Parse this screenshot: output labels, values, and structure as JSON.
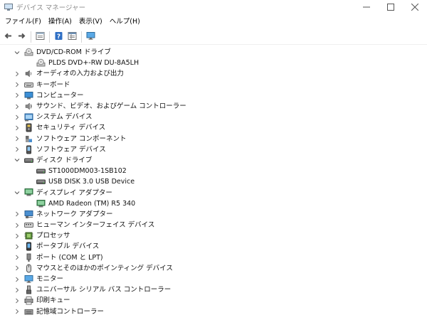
{
  "window": {
    "title": "デバイス マネージャー"
  },
  "menubar": [
    "ファイル(F)",
    "操作(A)",
    "表示(V)",
    "ヘルプ(H)"
  ],
  "toolbar": [
    {
      "name": "back-button",
      "icon": "arrow-left-icon"
    },
    {
      "name": "forward-button",
      "icon": "arrow-right-icon"
    },
    {
      "sep": true
    },
    {
      "name": "properties-button",
      "icon": "properties-icon"
    },
    {
      "sep": true
    },
    {
      "name": "help-button",
      "icon": "help-icon"
    },
    {
      "name": "view-button",
      "icon": "view-details-icon"
    },
    {
      "sep": true
    },
    {
      "name": "scan-hardware-button",
      "icon": "monitor-icon"
    }
  ],
  "tree": [
    {
      "level": 0,
      "label": "DVD/CD-ROM ドライブ",
      "expanded": true,
      "icon": "dvd-drive-icon"
    },
    {
      "level": 1,
      "label": "PLDS DVD+-RW DU-8A5LH",
      "icon": "dvd-drive-icon"
    },
    {
      "level": 0,
      "label": "オーディオの入力および出力",
      "expanded": false,
      "icon": "speaker-icon"
    },
    {
      "level": 0,
      "label": "キーボード",
      "expanded": false,
      "icon": "keyboard-icon"
    },
    {
      "level": 0,
      "label": "コンピューター",
      "expanded": false,
      "icon": "computer-icon"
    },
    {
      "level": 0,
      "label": "サウンド、ビデオ、およびゲーム コントローラー",
      "expanded": false,
      "icon": "sound-icon"
    },
    {
      "level": 0,
      "label": "システム デバイス",
      "expanded": false,
      "icon": "system-devices-icon"
    },
    {
      "level": 0,
      "label": "セキュリティ デバイス",
      "expanded": false,
      "icon": "security-icon"
    },
    {
      "level": 0,
      "label": "ソフトウェア コンポーネント",
      "expanded": false,
      "icon": "software-component-icon"
    },
    {
      "level": 0,
      "label": "ソフトウェア デバイス",
      "expanded": false,
      "icon": "software-device-icon"
    },
    {
      "level": 0,
      "label": "ディスク ドライブ",
      "expanded": true,
      "icon": "disk-drive-icon"
    },
    {
      "level": 1,
      "label": "ST1000DM003-1SB102",
      "icon": "disk-drive-icon"
    },
    {
      "level": 1,
      "label": "USB DISK 3.0 USB Device",
      "icon": "disk-drive-icon"
    },
    {
      "level": 0,
      "label": "ディスプレイ アダプター",
      "expanded": true,
      "icon": "display-adapter-icon"
    },
    {
      "level": 1,
      "label": "AMD Radeon (TM) R5 340",
      "icon": "display-adapter-icon"
    },
    {
      "level": 0,
      "label": "ネットワーク アダプター",
      "expanded": false,
      "icon": "network-icon"
    },
    {
      "level": 0,
      "label": "ヒューマン インターフェイス デバイス",
      "expanded": false,
      "icon": "hid-icon"
    },
    {
      "level": 0,
      "label": "プロセッサ",
      "expanded": false,
      "icon": "processor-icon"
    },
    {
      "level": 0,
      "label": "ポータブル デバイス",
      "expanded": false,
      "icon": "portable-device-icon"
    },
    {
      "level": 0,
      "label": "ポート (COM と LPT)",
      "expanded": false,
      "icon": "port-icon"
    },
    {
      "level": 0,
      "label": "マウスとそのほかのポインティング デバイス",
      "expanded": false,
      "icon": "mouse-icon"
    },
    {
      "level": 0,
      "label": "モニター",
      "expanded": false,
      "icon": "monitor-icon"
    },
    {
      "level": 0,
      "label": "ユニバーサル シリアル バス コントローラー",
      "expanded": false,
      "icon": "usb-icon"
    },
    {
      "level": 0,
      "label": "印刷キュー",
      "expanded": false,
      "icon": "printer-icon"
    },
    {
      "level": 0,
      "label": "記憶域コントローラー",
      "expanded": false,
      "icon": "storage-controller-icon"
    }
  ]
}
